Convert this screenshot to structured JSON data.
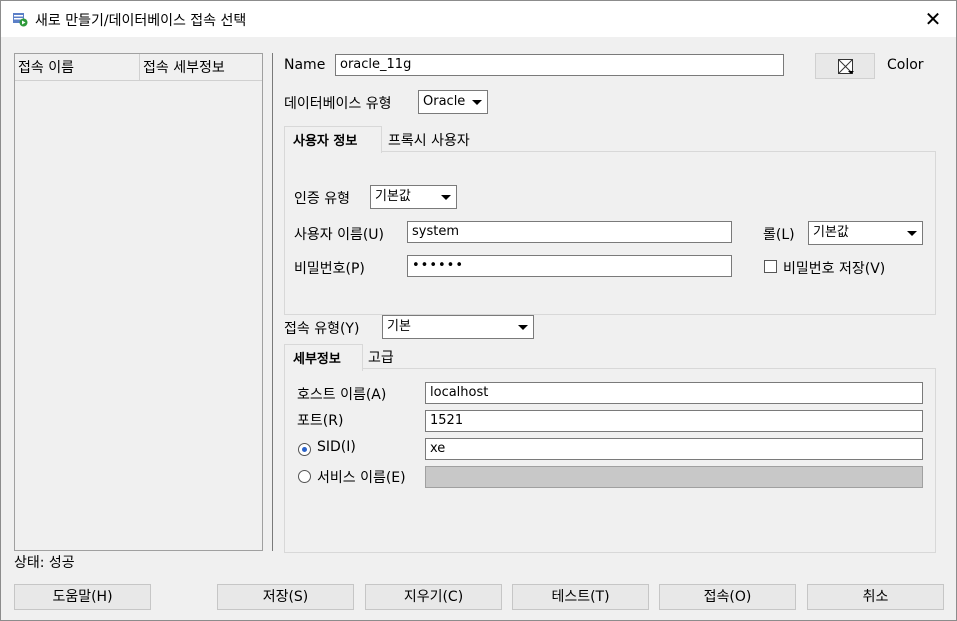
{
  "window": {
    "title": "새로 만들기/데이터베이스 접속 선택",
    "close_glyph": "✕"
  },
  "connections": {
    "col_name": "접속 이름",
    "col_detail": "접속 세부정보"
  },
  "form": {
    "name_label": "Name",
    "name_value": "oracle_11g",
    "color_label": "Color",
    "dbtype_label": "데이터베이스 유형",
    "dbtype_value": "Oracle",
    "user_tabs": [
      "사용자 정보",
      "프록시 사용자"
    ],
    "auth_label": "인증 유형",
    "auth_value": "기본값",
    "username_label": "사용자 이름(U)",
    "username_value": "system",
    "role_label": "롤(L)",
    "role_value": "기본값",
    "password_label": "비밀번호(P)",
    "password_value": "••••••",
    "save_password_label": "비밀번호 저장(V)",
    "conn_type_label": "접속 유형(Y)",
    "conn_type_value": "기본",
    "detail_tabs": [
      "세부정보",
      "고급"
    ],
    "host_label": "호스트 이름(A)",
    "host_value": "localhost",
    "port_label": "포트(R)",
    "port_value": "1521",
    "sid_label": "SID(I)",
    "sid_value": "xe",
    "service_label": "서비스 이름(E)",
    "service_value": ""
  },
  "status": {
    "text": "상태: 성공"
  },
  "buttons": {
    "help": "도움말(H)",
    "save": "저장(S)",
    "clear": "지우기(C)",
    "test": "테스트(T)",
    "connect": "접속(O)",
    "cancel": "취소"
  },
  "colors": {
    "accent": "#2a62c9",
    "icon_green": "#2e9a3a"
  }
}
